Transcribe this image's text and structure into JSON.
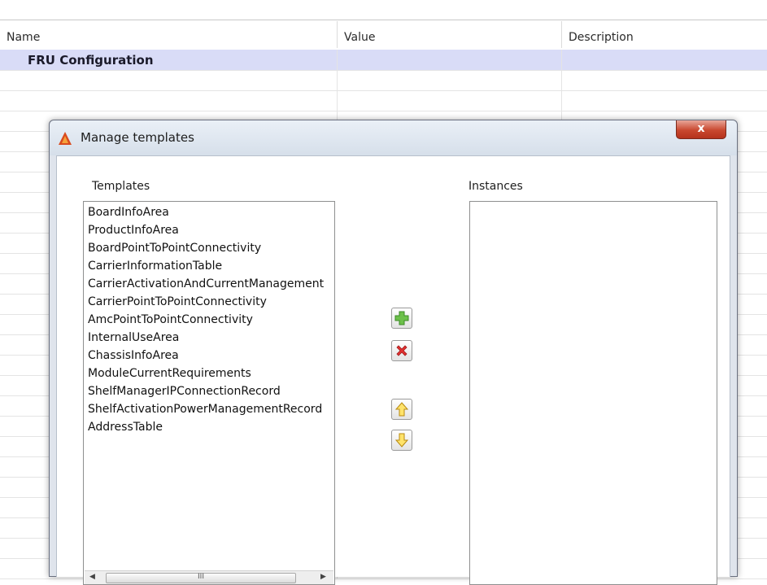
{
  "table": {
    "headers": [
      "Name",
      "Value",
      "Description"
    ],
    "selected_row": "FRU Configuration"
  },
  "dialog": {
    "title": "Manage templates",
    "close_label": "x",
    "templates_label": "Templates",
    "instances_label": "Instances",
    "templates": [
      "BoardInfoArea",
      "ProductInfoArea",
      "BoardPointToPointConnectivity",
      "CarrierInformationTable",
      "CarrierActivationAndCurrentManagement",
      "CarrierPointToPointConnectivity",
      "AmcPointToPointConnectivity",
      "InternalUseArea",
      "ChassisInfoArea",
      "ModuleCurrentRequirements",
      "ShelfManagerIPConnectionRecord",
      "ShelfActivationPowerManagementRecord",
      "AddressTable"
    ],
    "instances": [],
    "buttons": {
      "add_icon": "green-plus-icon",
      "remove_icon": "red-x-icon",
      "up_icon": "yellow-up-arrow-icon",
      "down_icon": "yellow-down-arrow-icon"
    },
    "scrollbar_grip": "III"
  }
}
